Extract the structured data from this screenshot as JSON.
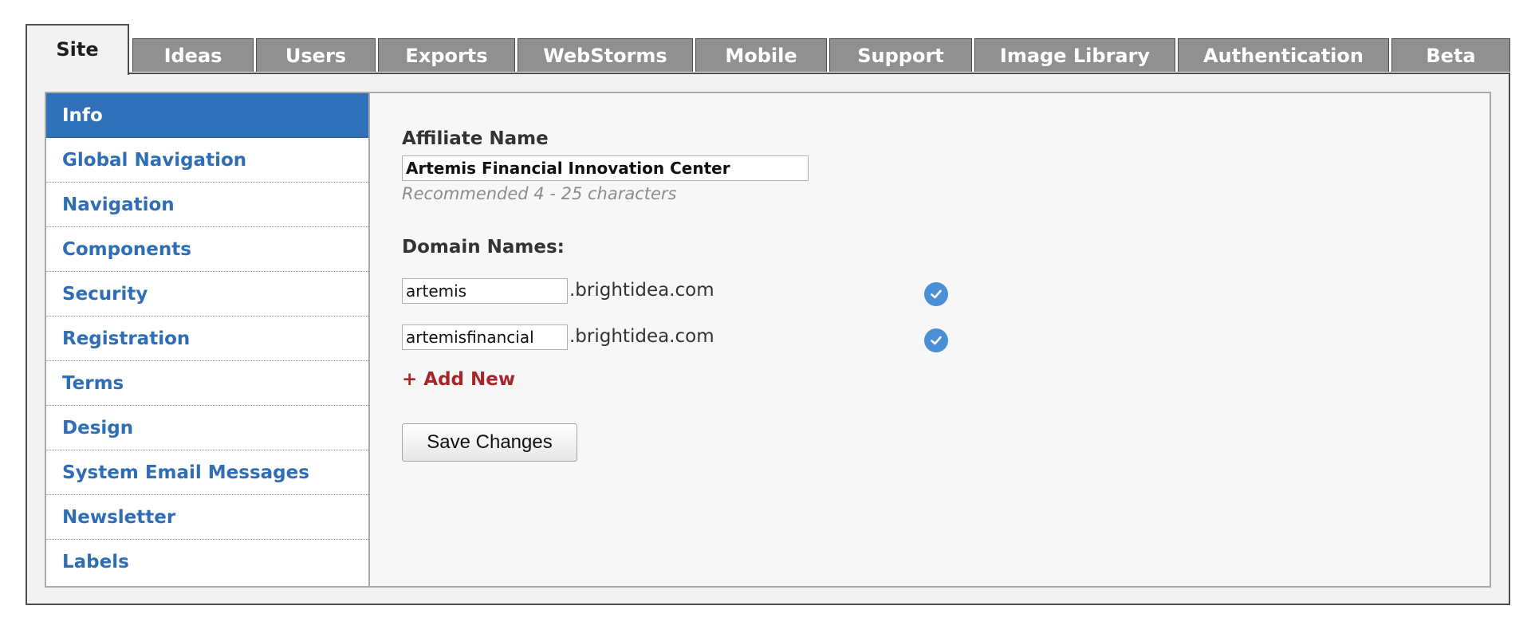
{
  "tabs": [
    {
      "label": "Site",
      "active": true
    },
    {
      "label": "Ideas"
    },
    {
      "label": "Users"
    },
    {
      "label": "Exports"
    },
    {
      "label": "WebStorms"
    },
    {
      "label": "Mobile"
    },
    {
      "label": "Support"
    },
    {
      "label": "Image Library"
    },
    {
      "label": "Authentication"
    },
    {
      "label": "Beta"
    }
  ],
  "sidebar": {
    "items": [
      {
        "label": "Info",
        "active": true
      },
      {
        "label": "Global Navigation"
      },
      {
        "label": "Navigation"
      },
      {
        "label": "Components"
      },
      {
        "label": "Security"
      },
      {
        "label": "Registration"
      },
      {
        "label": "Terms"
      },
      {
        "label": "Design"
      },
      {
        "label": "System Email Messages"
      },
      {
        "label": "Newsletter"
      },
      {
        "label": "Labels"
      }
    ]
  },
  "form": {
    "affiliate_label": "Affiliate Name",
    "affiliate_value": "Artemis Financial Innovation Center",
    "affiliate_hint": "Recommended 4 - 25 characters",
    "domains_label": "Domain Names:",
    "domains": [
      {
        "value": "artemis",
        "suffix": ".brightidea.com",
        "status_icon": "check-circle-icon"
      },
      {
        "value": "artemisfinancial",
        "suffix": ".brightidea.com",
        "status_icon": "check-circle-icon"
      }
    ],
    "add_new_label": "+ Add New",
    "save_label": "Save Changes"
  },
  "colors": {
    "tab_inactive": "#909090",
    "sidebar_active": "#2f71b8",
    "link_blue": "#2f6db5",
    "add_new_red": "#a6262a",
    "check_blue": "#4a90d6"
  }
}
